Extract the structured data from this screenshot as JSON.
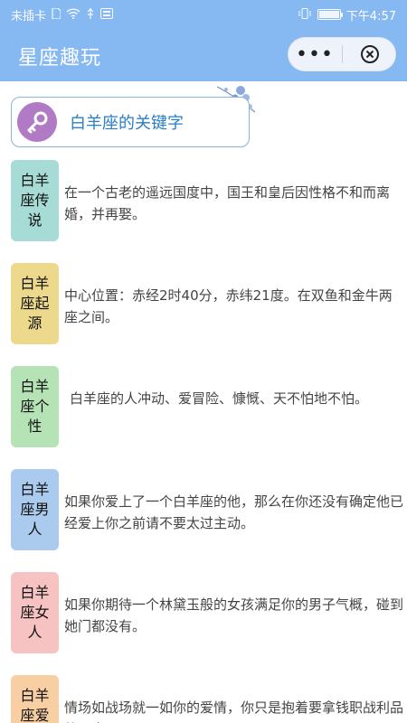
{
  "status_bar": {
    "left_text": "未插卡",
    "time": "下午4:57"
  },
  "nav": {
    "title": "星座趣玩",
    "more_label": "•••"
  },
  "keyword_card": {
    "title": "白羊座的关键字"
  },
  "items": [
    {
      "label": "白羊座传说",
      "text": "在一个古老的遥远国度中，国王和皇后因性格不和而离婚，并再娶。",
      "color": "#a7dcd6"
    },
    {
      "label": "白羊座起源",
      "text": "中心位置：赤经2时40分，赤纬21度。在双鱼和金牛两座之间。",
      "color": "#ecd98c"
    },
    {
      "label": "白羊座个性",
      "text": "白羊座的人冲动、爱冒险、慷慨、天不怕地不怕。",
      "color": "#b5e3b6"
    },
    {
      "label": "白羊座男人",
      "text": "如果你爱上了一个白羊座的他，那么在你还没有确定他已经爱上你之前请不要太过主动。",
      "color": "#aacaee"
    },
    {
      "label": "白羊座女人",
      "text": "如果你期待一个林黛玉般的女孩满足你的男子气概，碰到她门都没有。",
      "color": "#f6c2c2"
    },
    {
      "label": "白羊座爱情",
      "text": "情场如战场就一如你的爱情，你只是抱着要拿钱职战利品的心态",
      "color": "#f8cfa2"
    }
  ]
}
